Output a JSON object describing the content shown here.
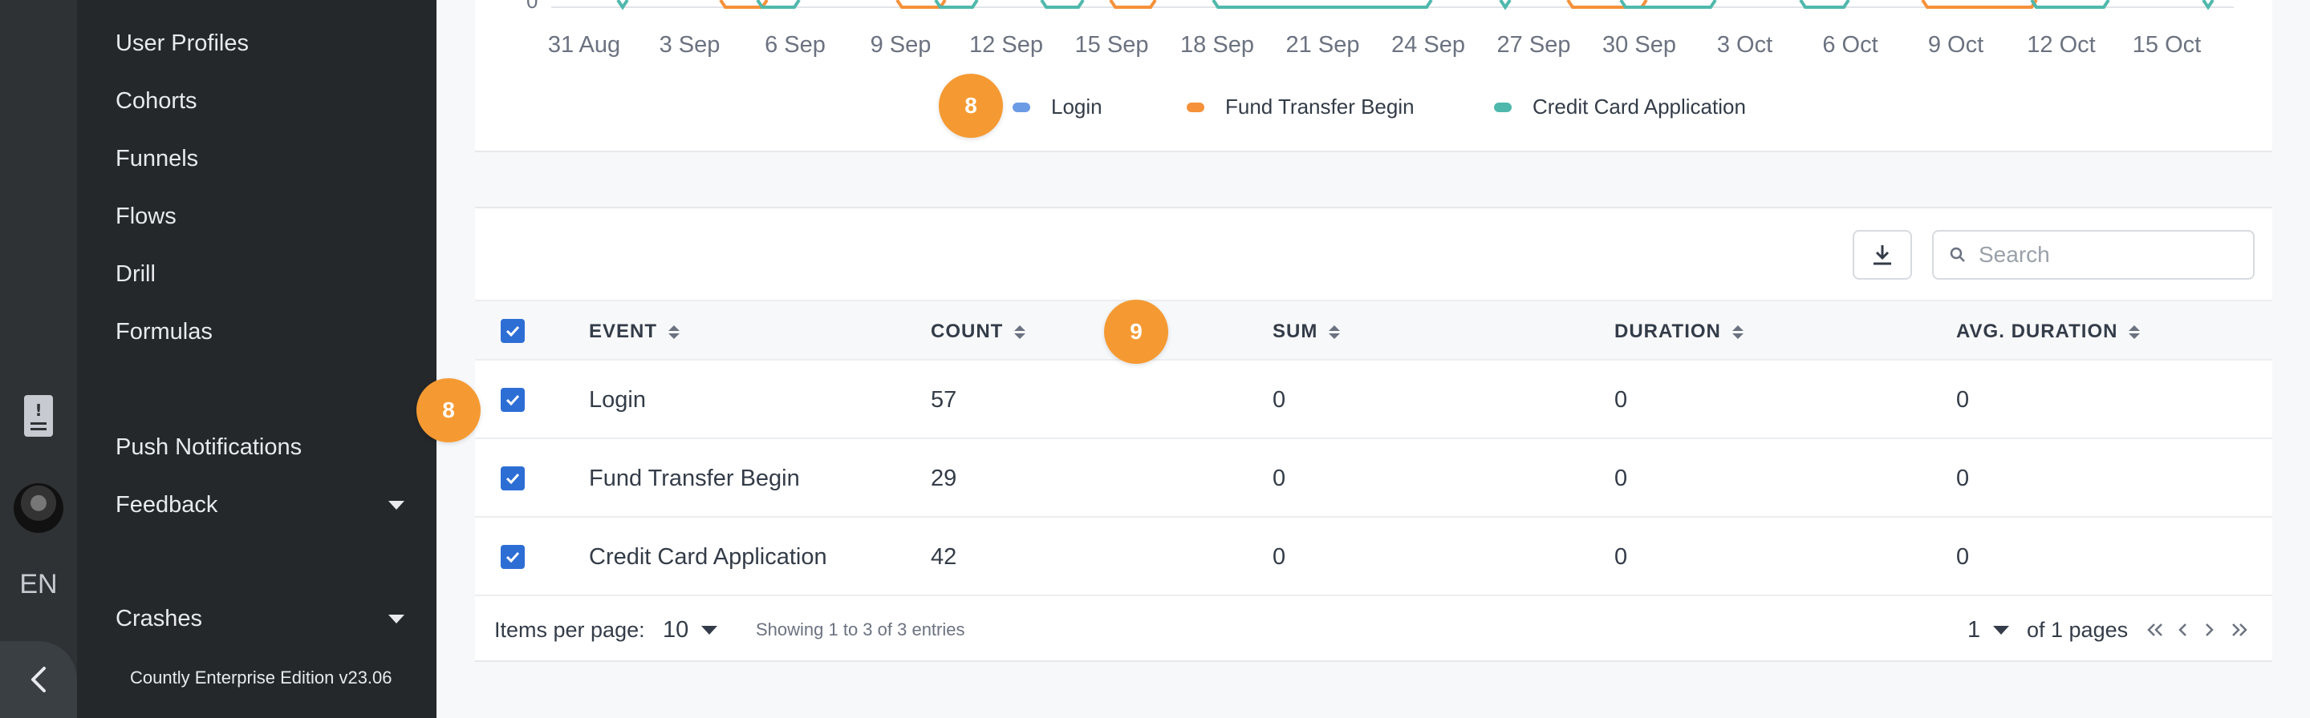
{
  "sidebar": {
    "items": [
      {
        "label": "User Profiles"
      },
      {
        "label": "Cohorts"
      },
      {
        "label": "Funnels"
      },
      {
        "label": "Flows"
      },
      {
        "label": "Drill"
      },
      {
        "label": "Formulas"
      },
      {
        "label": "Push Notifications"
      },
      {
        "label": "Feedback"
      },
      {
        "label": "Crashes"
      }
    ],
    "edition": "Countly Enterprise Edition v23.06"
  },
  "rail": {
    "language": "EN"
  },
  "chart": {
    "y_tick": "0",
    "x_ticks": [
      "31 Aug",
      "3 Sep",
      "6 Sep",
      "9 Sep",
      "12 Sep",
      "15 Sep",
      "18 Sep",
      "21 Sep",
      "24 Sep",
      "27 Sep",
      "30 Sep",
      "3 Oct",
      "6 Oct",
      "9 Oct",
      "12 Oct",
      "15 Oct"
    ],
    "legend": [
      {
        "name": "Login",
        "color": "#6c9be6"
      },
      {
        "name": "Fund Transfer Begin",
        "color": "#f5913a"
      },
      {
        "name": "Credit Card Application",
        "color": "#4fb8ac"
      }
    ]
  },
  "badges": {
    "legend_badge": "8",
    "header_badge": "9",
    "row_badge": "8"
  },
  "table": {
    "search_placeholder": "Search",
    "columns": [
      "EVENT",
      "COUNT",
      "SUM",
      "DURATION",
      "AVG. DURATION"
    ],
    "rows": [
      {
        "event": "Login",
        "count": "57",
        "sum": "0",
        "duration": "0",
        "avg_duration": "0"
      },
      {
        "event": "Fund Transfer Begin",
        "count": "29",
        "sum": "0",
        "duration": "0",
        "avg_duration": "0"
      },
      {
        "event": "Credit Card Application",
        "count": "42",
        "sum": "0",
        "duration": "0",
        "avg_duration": "0"
      }
    ],
    "footer": {
      "items_per_page_label": "Items per page:",
      "items_per_page_value": "10",
      "showing": "Showing 1 to 3 of 3 entries",
      "page_value": "1",
      "of_pages": "of 1 pages"
    }
  }
}
